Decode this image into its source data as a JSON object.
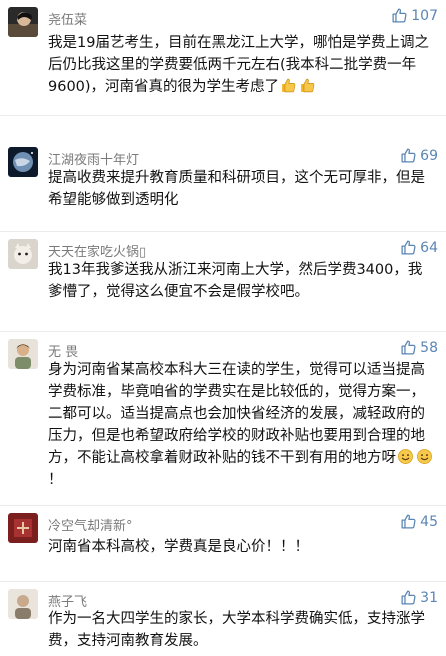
{
  "comments": [
    {
      "username": "尧伍菜",
      "likes": "107",
      "text": "我是19届艺考生，目前在黑龙江上大学，哪怕是学费上调之后仍比我这里的学费要低两千元左右(我本科二批学费一年9600)，河南省真的很为学生考虑了",
      "trailing_emoji": [
        "thumbs-up-emoji",
        "thumbs-up-emoji"
      ]
    },
    {
      "username": "江湖夜雨十年灯",
      "likes": "69",
      "text": "提高收费来提升教育质量和科研项目，这个无可厚非，但是希望能够做到透明化"
    },
    {
      "username": "天天在家吃火锅▯",
      "likes": "64",
      "text": "我13年我爹送我从浙江来河南上大学，然后学费3400，我爹懵了，觉得这么便宜不会是假学校吧。"
    },
    {
      "username": "无 畏",
      "likes": "58",
      "text": "身为河南省某高校本科大三在读的学生，觉得可以适当提高学费标准，毕竟咱省的学费实在是比较低的，觉得方案一，二都可以。适当提高点也会加快省经济的发展，减轻政府的压力，但是也希望政府给学校的财政补贴也要用到合理的地方，不能让高校拿着财政补贴的钱不干到有用的地方呀",
      "trailing_emoji": [
        "smile-emoji",
        "smile-emoji"
      ],
      "tail": "！"
    },
    {
      "username": "冷空气却清新°",
      "likes": "45",
      "text": "河南省本科高校，学费真是良心价！！！"
    },
    {
      "username": "燕子飞",
      "likes": "31",
      "text": "作为一名大四学生的家长，大学本科学费确实低，支持涨学费，支持河南教育发展。"
    }
  ],
  "colors": {
    "username": "#7a7a7a",
    "like": "#5b86b4",
    "text": "#111111",
    "divider": "#ececec"
  },
  "icons": {
    "like": "thumbs-up-icon"
  }
}
